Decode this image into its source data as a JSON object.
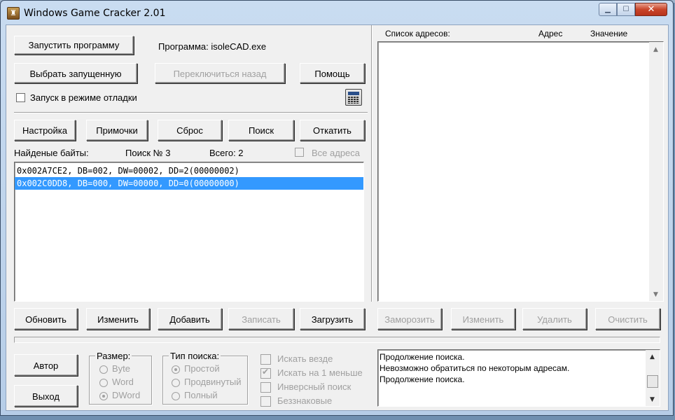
{
  "window": {
    "title": "Windows Game Cracker 2.01"
  },
  "top": {
    "run_program": "Запустить программу",
    "program_label": "Программа:",
    "program_name": "isoleCAD.exe",
    "select_running": "Выбрать запущенную",
    "switch_back": "Переключиться назад",
    "help": "Помощь",
    "debug_mode": "Запуск в режиме отладки"
  },
  "toolbar": {
    "settings": "Настройка",
    "notes": "Примочки",
    "reset": "Сброс",
    "search": "Поиск",
    "rollback": "Откатить"
  },
  "found": {
    "label": "Найденые байты:",
    "search_no": "Поиск № 3",
    "total": "Всего:  2",
    "all_addresses": "Все адреса",
    "rows": [
      {
        "text": "0x002A7CE2, DB=002, DW=00002, DD=2(00000002)",
        "selected": false
      },
      {
        "text": "0x002C0DD8, DB=000, DW=00000, DD=0(00000000)",
        "selected": true
      }
    ]
  },
  "bottom_left_buttons": {
    "refresh": "Обновить",
    "change": "Изменить",
    "add": "Добавить",
    "write": "Записать",
    "load": "Загрузить"
  },
  "address_list": {
    "title": "Список адресов:",
    "col_address": "Адрес",
    "col_value": "Значение"
  },
  "address_buttons": {
    "freeze": "Заморозить",
    "change": "Изменить",
    "delete": "Удалить",
    "clear": "Очистить"
  },
  "footer": {
    "author": "Автор",
    "exit": "Выход",
    "size_group": {
      "title": "Размер:",
      "options": [
        "Byte",
        "Word",
        "DWord"
      ],
      "selected": "DWord"
    },
    "search_type_group": {
      "title": "Тип поиска:",
      "options": [
        "Простой",
        "Продвинутый",
        "Полный"
      ],
      "selected": "Простой"
    },
    "checks": [
      {
        "label": "Искать везде",
        "checked": false
      },
      {
        "label": "Искать на 1 меньше",
        "checked": true
      },
      {
        "label": "Инверсный поиск",
        "checked": false
      },
      {
        "label": "Беззнаковые",
        "checked": false
      }
    ],
    "log": [
      "Продолжение поиска.",
      "Невозможно обратиться по некоторым адресам.",
      "Продолжение поиска."
    ]
  }
}
